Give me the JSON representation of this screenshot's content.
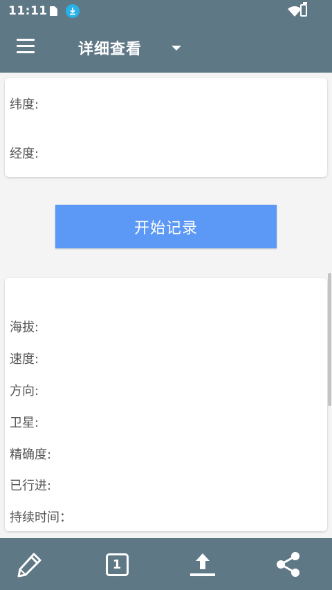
{
  "status_bar": {
    "time": "11:11"
  },
  "app_bar": {
    "title": "详细查看"
  },
  "location_card": {
    "latitude_label": "纬度:",
    "longitude_label": "经度:"
  },
  "record_button": {
    "label": "开始记录"
  },
  "details_card": {
    "altitude_label": "海拔:",
    "speed_label": "速度:",
    "direction_label": "方向:",
    "satellite_label": "卫星:",
    "accuracy_label": "精确度:",
    "traveled_label": "已行进:",
    "duration_label": "持续时间："
  },
  "bottom_bar": {
    "page_number": "1"
  },
  "colors": {
    "bar": "#5f7885",
    "accent_button": "#5c98f5",
    "background": "#f4f4f4"
  }
}
